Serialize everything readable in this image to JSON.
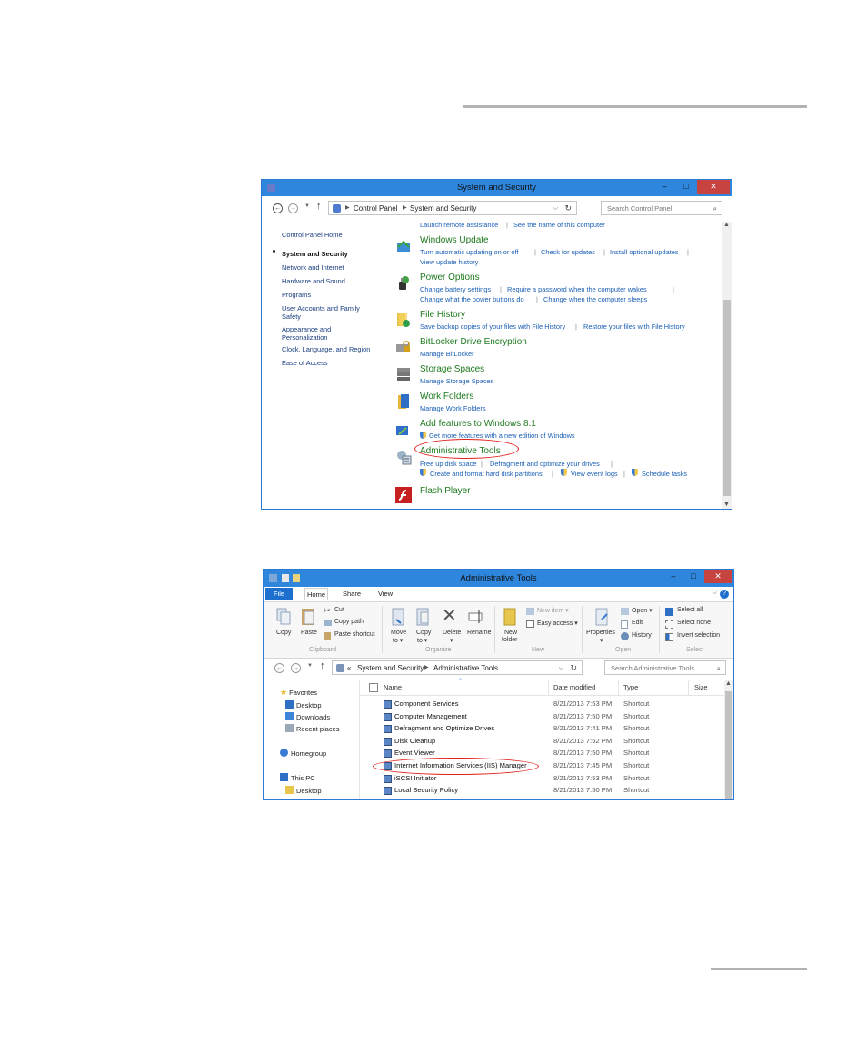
{
  "cp_window": {
    "title": "System and Security",
    "minimize": "–",
    "maximize": "□",
    "close": "✕",
    "breadcrumb": [
      "Control Panel",
      "System and Security"
    ],
    "search_placeholder": "Search Control Panel",
    "sidebar": [
      "Control Panel Home",
      "System and Security",
      "Network and Internet",
      "Hardware and Sound",
      "Programs",
      "User Accounts and Family",
      "Safety",
      "Appearance and",
      "Personalization",
      "Clock, Language, and Region",
      "Ease of Access"
    ],
    "top_links": [
      "Launch remote assistance",
      "See the name of this computer"
    ],
    "sections": [
      {
        "title": "Windows Update",
        "icon": "windows-update-icon",
        "links": [
          [
            "Turn automatic updating on or off",
            "Check for updates",
            "Install optional updates"
          ],
          [
            "View update history"
          ]
        ]
      },
      {
        "title": "Power Options",
        "icon": "power-options-icon",
        "links": [
          [
            "Change battery settings",
            "Require a password when the computer wakes"
          ],
          [
            "Change what the power buttons do",
            "Change when the computer sleeps"
          ]
        ]
      },
      {
        "title": "File History",
        "icon": "file-history-icon",
        "links": [
          [
            "Save backup copies of your files with File History",
            "Restore your files with File History"
          ]
        ]
      },
      {
        "title": "BitLocker Drive Encryption",
        "icon": "bitlocker-icon",
        "links": [
          [
            "Manage BitLocker"
          ]
        ]
      },
      {
        "title": "Storage Spaces",
        "icon": "storage-spaces-icon",
        "links": [
          [
            "Manage Storage Spaces"
          ]
        ]
      },
      {
        "title": "Work Folders",
        "icon": "work-folders-icon",
        "links": [
          [
            "Manage Work Folders"
          ]
        ]
      },
      {
        "title": "Add features to Windows 8.1",
        "icon": "add-features-icon",
        "links": [
          [
            "Get more features with a new edition of Windows"
          ]
        ]
      },
      {
        "title": "Administrative Tools",
        "icon": "administrative-tools-icon",
        "links": [
          [
            "Free up disk space",
            "Defragment and optimize your drives"
          ],
          [
            "Create and format hard disk partitions",
            "View event logs",
            "Schedule tasks"
          ]
        ]
      },
      {
        "title": "Flash Player",
        "icon": "flash-player-icon",
        "links": []
      }
    ]
  },
  "at_window": {
    "title": "Administrative Tools",
    "tabs": [
      "File",
      "Home",
      "Share",
      "View"
    ],
    "help": "?",
    "ribbon": {
      "clipboard": {
        "copy": "Copy",
        "paste": "Paste",
        "cut": "Cut",
        "copy_path": "Copy path",
        "paste_shortcut": "Paste shortcut",
        "label": "Clipboard"
      },
      "organize": {
        "move_to": "Move",
        "move_to2": "to ▾",
        "copy_to": "Copy",
        "copy_to2": "to ▾",
        "delete": "Delete",
        "delete2": "▾",
        "rename": "Rename",
        "label": "Organize"
      },
      "new": {
        "new_folder": "New",
        "new_folder2": "folder",
        "new_item": "New item ▾",
        "easy_access": "Easy access ▾",
        "label": "New"
      },
      "open": {
        "properties": "Properties",
        "properties2": "▾",
        "open": "Open ▾",
        "edit": "Edit",
        "history": "History",
        "label": "Open"
      },
      "select": {
        "select_all": "Select all",
        "select_none": "Select none",
        "invert": "Invert selection",
        "label": "Select"
      }
    },
    "breadcrumb": [
      "«",
      "System and Security",
      "Administrative Tools"
    ],
    "search_placeholder": "Search Administrative Tools",
    "nav": {
      "favorites": "Favorites",
      "desktop": "Desktop",
      "downloads": "Downloads",
      "recent": "Recent places",
      "homegroup": "Homegroup",
      "thispc": "This PC",
      "pc_desktop": "Desktop"
    },
    "columns": [
      "Name",
      "Date modified",
      "Type",
      "Size"
    ],
    "files": [
      {
        "name": "Component Services",
        "date": "8/21/2013 7:53 PM",
        "type": "Shortcut"
      },
      {
        "name": "Computer Management",
        "date": "8/21/2013 7:50 PM",
        "type": "Shortcut"
      },
      {
        "name": "Defragment and Optimize Drives",
        "date": "8/21/2013 7:41 PM",
        "type": "Shortcut"
      },
      {
        "name": "Disk Cleanup",
        "date": "8/21/2013 7:52 PM",
        "type": "Shortcut"
      },
      {
        "name": "Event Viewer",
        "date": "8/21/2013 7:50 PM",
        "type": "Shortcut"
      },
      {
        "name": "Internet Information Services (IIS) Manager",
        "date": "8/21/2013 7:45 PM",
        "type": "Shortcut"
      },
      {
        "name": "iSCSI Initiator",
        "date": "8/21/2013 7:53 PM",
        "type": "Shortcut"
      },
      {
        "name": "Local Security Policy",
        "date": "8/21/2013 7:50 PM",
        "type": "Shortcut"
      }
    ]
  }
}
